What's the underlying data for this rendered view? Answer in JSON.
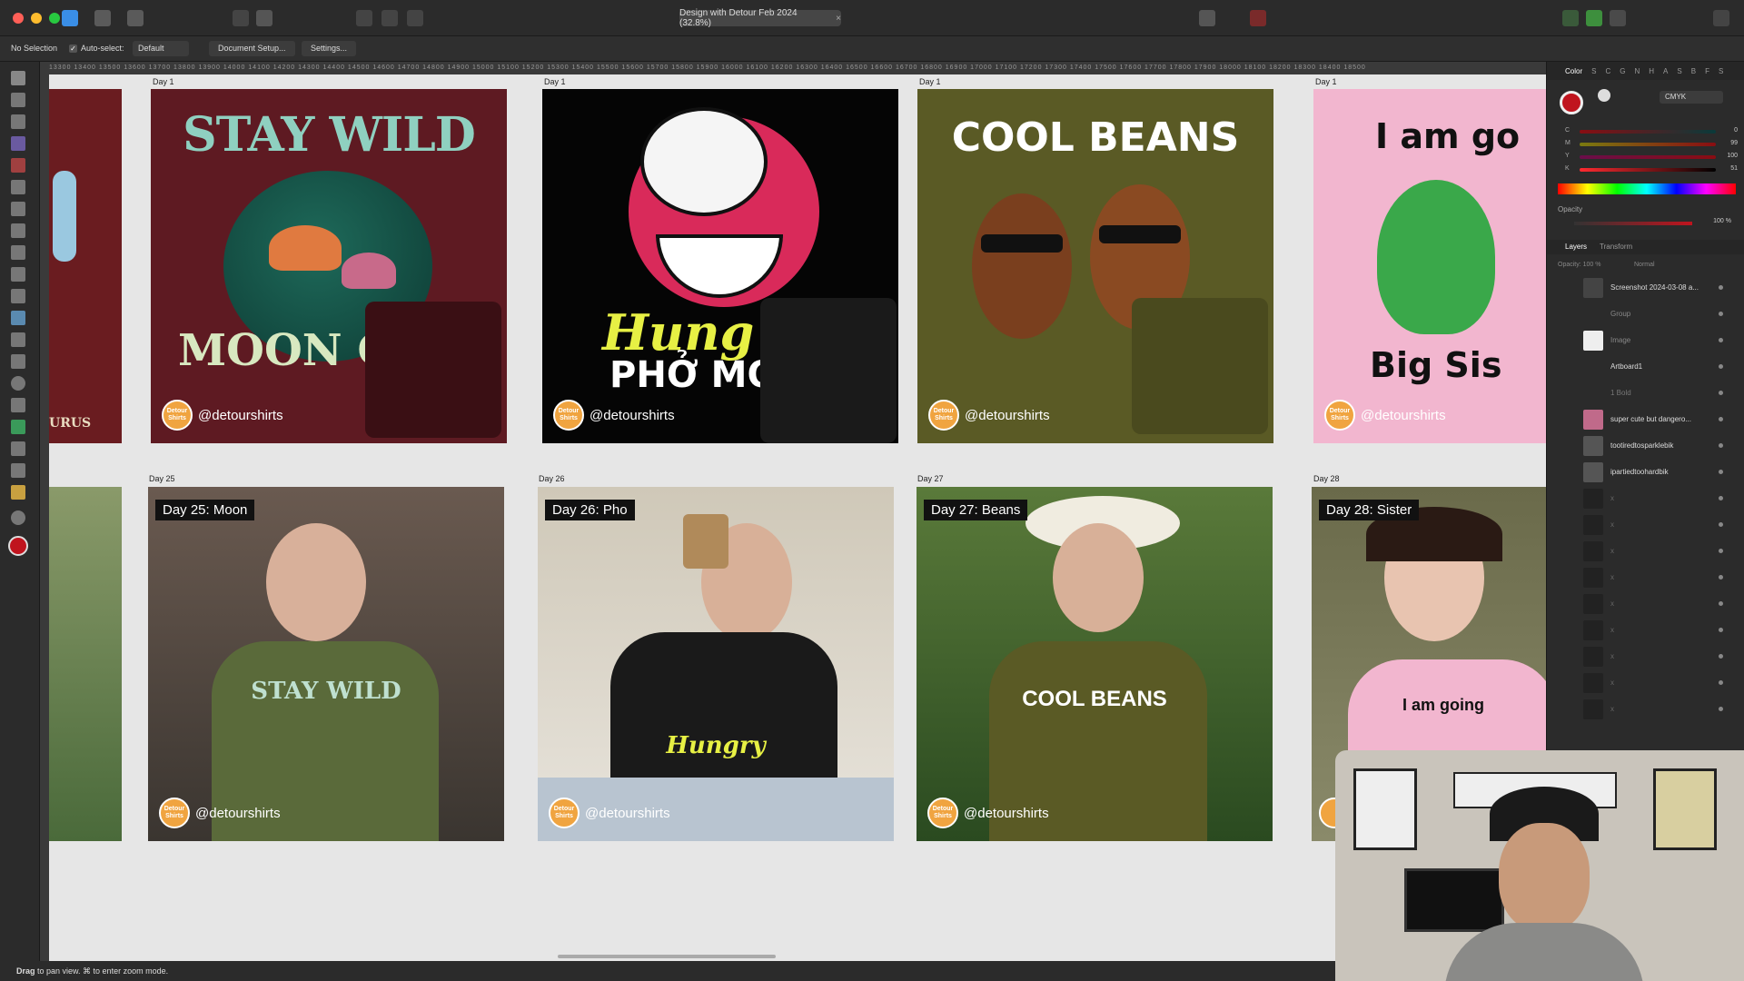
{
  "titlebar": {
    "doc_title": "Design with Detour Feb 2024 (32.8%)",
    "close": "×"
  },
  "context": {
    "selection": "No Selection",
    "autoselect_label": "Auto-select:",
    "autoselect_check": "✓",
    "mode": "Default",
    "doc_setup": "Document Setup...",
    "settings": "Settings..."
  },
  "ruler": {
    "ticks": "13300 13400 13500 13600 13700 13800 13900 14000 14100 14200 14300 14400 14500 14600 14700 14800 14900 15000 15100 15200 15300 15400 15500 15600 15700 15800 15900 16000 16100 16200 16300 16400 16500 16600 16700 16800 16900 17000 17100 17200 17300 17400 17500 17600 17700 17800 17900 18000 18100 18200 18300 18400 18500"
  },
  "top_row": [
    {
      "label": "Day 1",
      "title_top": "STAY WILD",
      "title_bottom": "MOON CH",
      "handle": "@detourshirts"
    },
    {
      "label": "Day 1",
      "title_top": "Hung",
      "title_bottom": "PHỞ MO",
      "handle": "@detourshirts"
    },
    {
      "label": "Day 1",
      "title_top": "COOL BEANS",
      "title_bottom": "",
      "handle": "@detourshirts"
    },
    {
      "label": "Day 1",
      "title_top": "I am go",
      "title_bottom": "Big Sis",
      "handle": "@detourshirts"
    }
  ],
  "bottom_row": [
    {
      "label": "Day 25",
      "tag": "Day 25: Moon",
      "handle": "@detourshirts",
      "shirt": "STAY WILD"
    },
    {
      "label": "Day 26",
      "tag": "Day 26: Pho",
      "handle": "@detourshirts",
      "shirt": "Hungry"
    },
    {
      "label": "Day 27",
      "tag": "Day 27: Beans",
      "handle": "@detourshirts",
      "shirt": "COOL BEANS"
    },
    {
      "label": "Day 28",
      "tag": "Day 28: Sister",
      "handle": "",
      "shirt": "I am going"
    }
  ],
  "left_partial": {
    "text": "URUS"
  },
  "logo_text": "Detour Shirts",
  "panel": {
    "tabs": [
      "Color",
      "S",
      "C",
      "G",
      "N",
      "H",
      "A",
      "S",
      "B",
      "F",
      "S"
    ],
    "color_model": "CMYK",
    "channels": [
      {
        "name": "C",
        "value": "0"
      },
      {
        "name": "M",
        "value": "99"
      },
      {
        "name": "Y",
        "value": "100"
      },
      {
        "name": "K",
        "value": "51"
      }
    ],
    "opacity_label": "Opacity",
    "opacity_value": "100 %",
    "layer_tabs": [
      "Layers",
      "Transform"
    ],
    "layer_opacity": "Opacity: 100 %",
    "blend": "Normal",
    "layers": [
      "Screenshot 2024-03-08 a...",
      "Group",
      "Image",
      "Artboard1",
      "1 Bold",
      "super cute but dangero...",
      "tootiredtosparklebik",
      "ipartiedtoohardbik",
      "x",
      "x",
      "x",
      "x",
      "x",
      "x",
      "x",
      "x",
      "x"
    ]
  },
  "status": {
    "hint_strong": "Drag",
    "hint_rest": " to pan view. ⌘ to enter zoom mode."
  },
  "colors": {
    "accent_red": "#c0141e",
    "artboard_maroon": "#5e1a22",
    "artboard_olive": "#5a5a25",
    "artboard_pink": "#f2b6cf",
    "logo_orange": "#f0a440"
  }
}
